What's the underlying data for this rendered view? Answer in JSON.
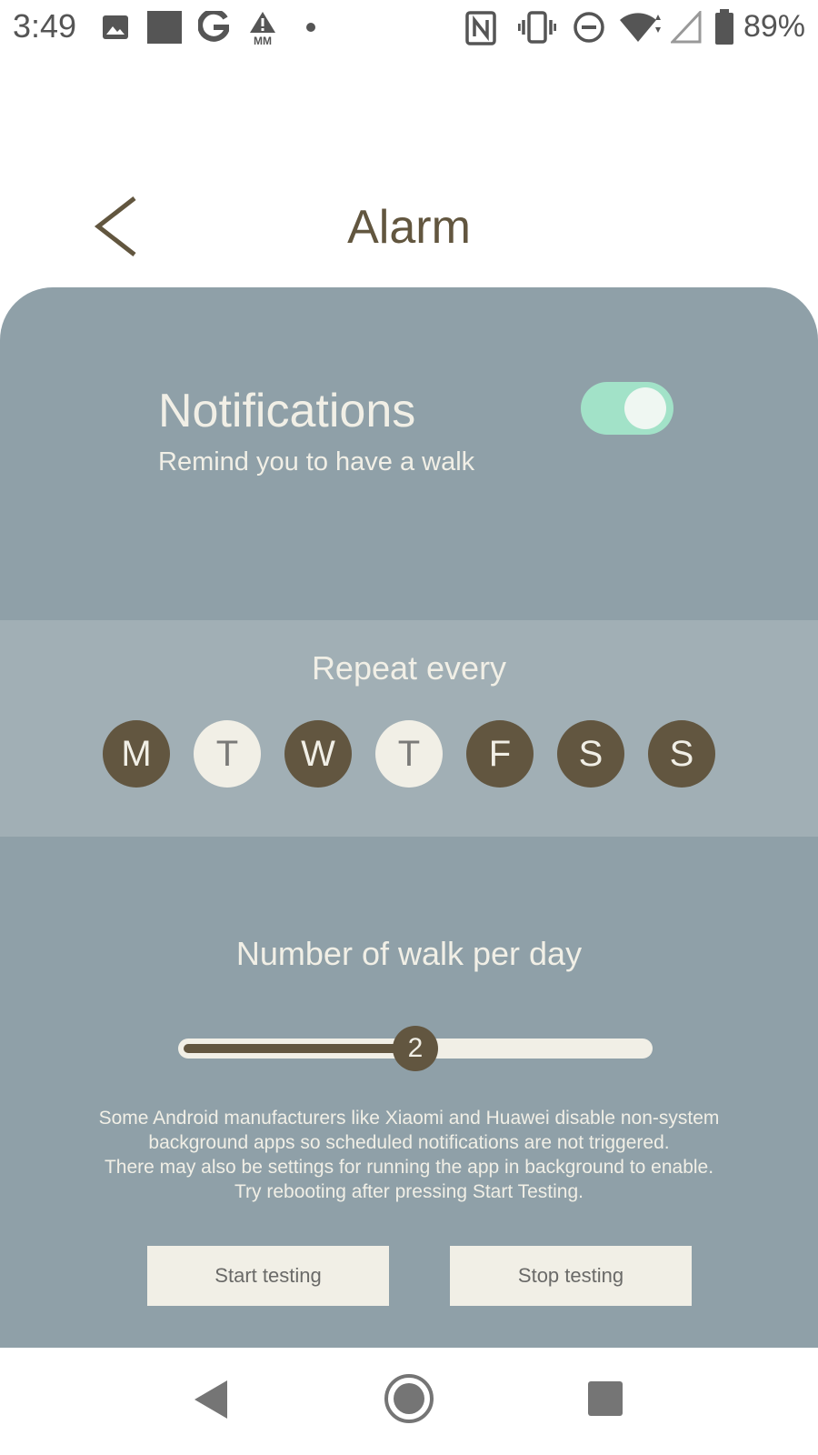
{
  "status_bar": {
    "time": "3:49",
    "battery_percent": "89%",
    "icons": [
      "image-icon",
      "square-icon",
      "google-g-icon",
      "mm-alert-icon",
      "dot-icon",
      "nfc-icon",
      "vibrate-icon",
      "do-not-disturb-icon",
      "wifi-icon",
      "signal-icon",
      "battery-icon"
    ]
  },
  "header": {
    "title": "Alarm",
    "back_icon": "back-chevron-icon"
  },
  "notifications": {
    "title": "Notifications",
    "subtitle": "Remind you to have a walk",
    "enabled": true
  },
  "repeat": {
    "label": "Repeat every",
    "days": [
      {
        "letter": "M",
        "selected": true
      },
      {
        "letter": "T",
        "selected": false
      },
      {
        "letter": "W",
        "selected": true
      },
      {
        "letter": "T",
        "selected": false
      },
      {
        "letter": "F",
        "selected": true
      },
      {
        "letter": "S",
        "selected": true
      },
      {
        "letter": "S",
        "selected": true
      }
    ]
  },
  "walks": {
    "label": "Number of walk per day",
    "value": "2",
    "fraction": 0.5
  },
  "note": {
    "lines": [
      "Some Android manufacturers like Xiaomi and Huawei disable non-system",
      "background apps so scheduled notifications are not triggered.",
      "There may also be settings for running the app in background to enable.",
      "Try rebooting after pressing Start Testing."
    ]
  },
  "buttons": {
    "start": "Start testing",
    "stop": "Stop testing"
  },
  "nav": {
    "icons": [
      "nav-back-icon",
      "nav-home-icon",
      "nav-recents-icon"
    ]
  },
  "colors": {
    "accent": "#625640",
    "panel": "#8fa0a8",
    "band": "#a1afb5",
    "toggle_on": "#a2e2c8",
    "light": "#f1efe6"
  }
}
